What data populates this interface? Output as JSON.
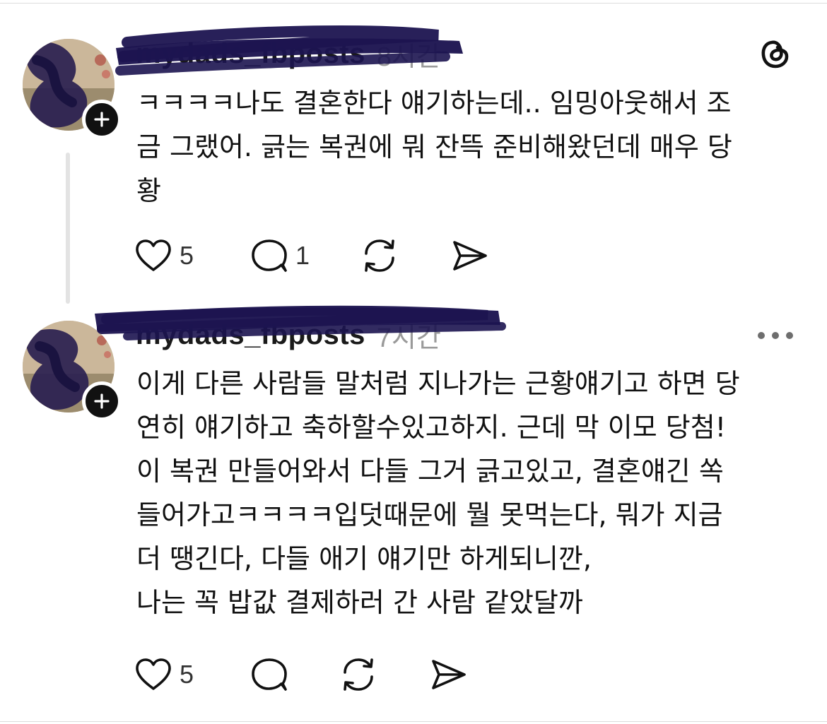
{
  "posts": [
    {
      "username": "mydads_fbposts",
      "timestamp": "8시간",
      "text_lines": [
        "ㅋㅋㅋㅋ나도 결혼한다 얘기하는데.. 임밍아웃해서 조",
        "금 그랬어. 긁는 복권에 뭐 잔뜩 준비해왔던데 매우 당",
        "황"
      ],
      "likes": "5",
      "replies": "1",
      "header_icon": "threads-logo-icon"
    },
    {
      "username": "mydads_fbposts",
      "timestamp": "7시간",
      "text_lines": [
        "이게 다른 사람들 말처럼 지나가는 근황얘기고 하면 당",
        "연히 얘기하고 축하할수있고하지. 근데 막 이모 당첨!",
        "이 복권 만들어와서 다들 그거 긁고있고, 결혼얘긴 쏙",
        "들어가고ㅋㅋㅋㅋ입덧때문에 뭘 못먹는다, 뭐가 지금",
        "더 땡긴다, 다들 애기 얘기만 하게되니깐,",
        "나는 꼭 밥값 결제하러 간 사람 같았달까"
      ],
      "likes": "5",
      "replies": "",
      "header_icon": "more-options-icon"
    }
  ],
  "icons": {
    "like": "heart-icon",
    "reply": "comment-icon",
    "repost": "repost-icon",
    "share": "send-icon",
    "follow": "plus-icon"
  },
  "colors": {
    "text": "#111111",
    "muted": "#9a9a9a",
    "scribble": "#1c1450",
    "badge": "#111111"
  }
}
